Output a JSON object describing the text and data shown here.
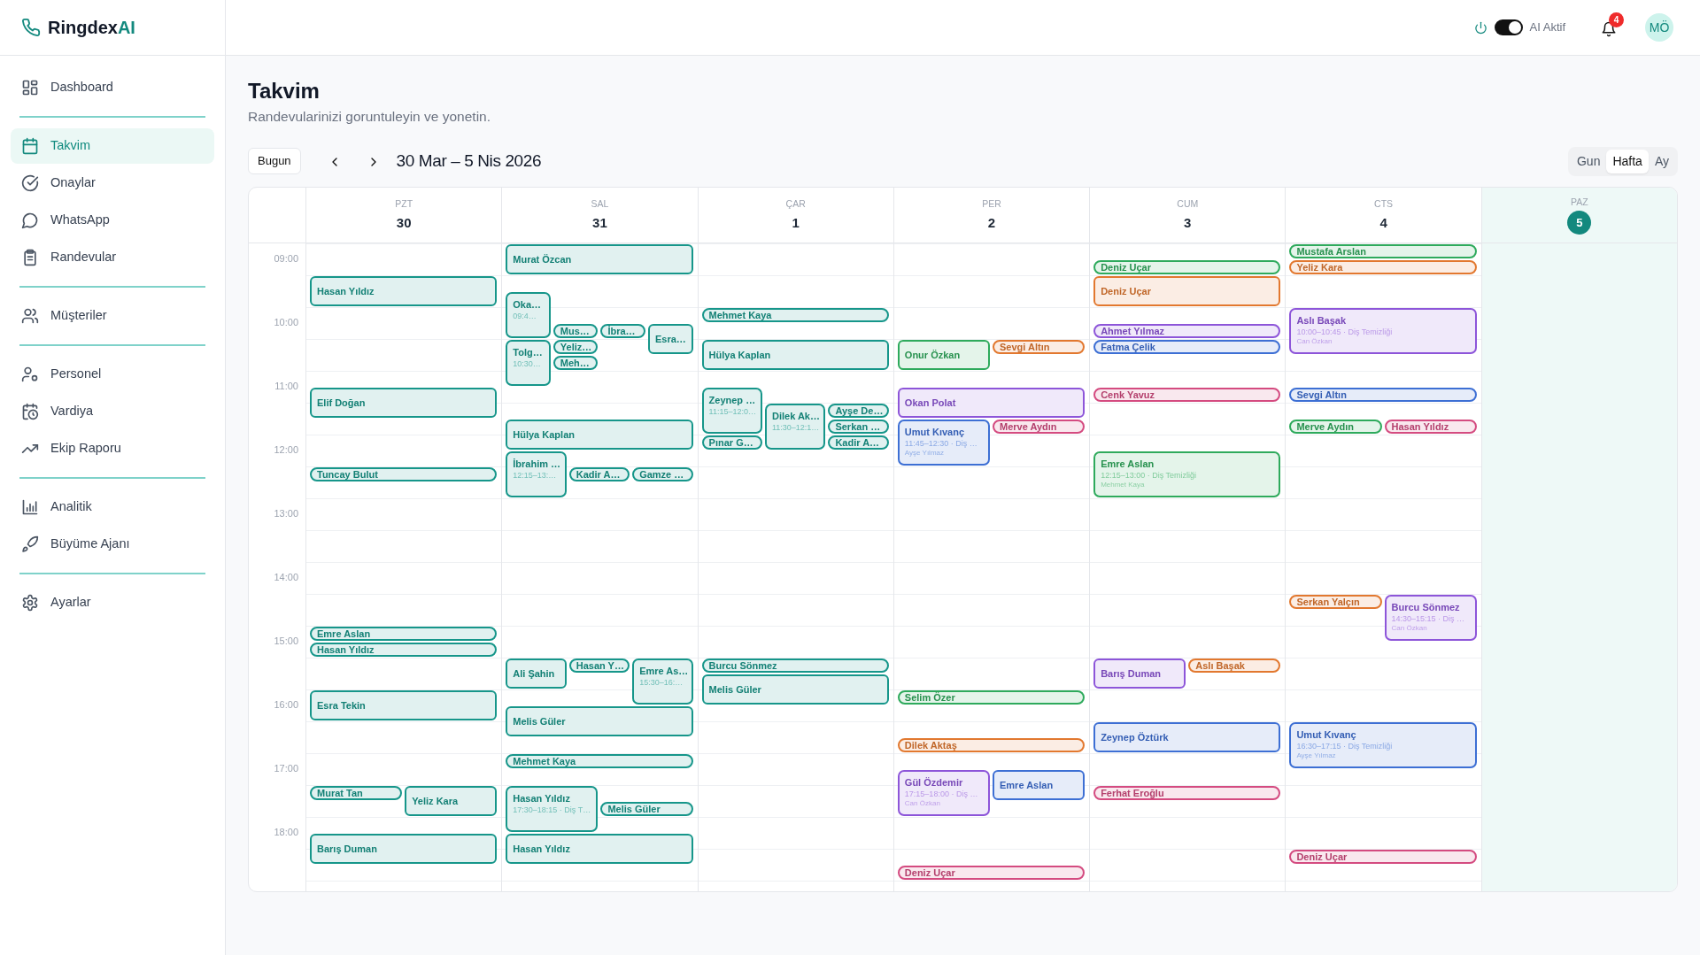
{
  "logo": {
    "name": "Ringdex",
    "suffix": "AI"
  },
  "sidebar": {
    "groups": [
      [
        {
          "label": "Dashboard",
          "selected": false
        }
      ],
      [
        {
          "label": "Takvim",
          "selected": true
        },
        {
          "label": "Onaylar",
          "selected": false
        },
        {
          "label": "WhatsApp",
          "selected": false
        },
        {
          "label": "Randevular",
          "selected": false
        }
      ],
      [
        {
          "label": "Müşteriler",
          "selected": false
        }
      ],
      [
        {
          "label": "Personel",
          "selected": false
        },
        {
          "label": "Vardiya",
          "selected": false
        },
        {
          "label": "Ekip Raporu",
          "selected": false
        }
      ],
      [
        {
          "label": "Analitik",
          "selected": false
        },
        {
          "label": "Büyüme Ajanı",
          "selected": false
        }
      ],
      [
        {
          "label": "Ayarlar",
          "selected": false
        }
      ]
    ]
  },
  "topbar": {
    "ai_toggle": {
      "label": "AI Aktif",
      "on": true
    },
    "notifications": {
      "count": "4"
    },
    "avatar": "MÖ"
  },
  "page": {
    "title": "Takvim",
    "subtitle": "Randevularinizi goruntuleyin ve yonetin."
  },
  "toolbar": {
    "today_button": "Bugun",
    "range": "30 Mar – 5 Nis 2026",
    "views": [
      {
        "label": "Gun",
        "selected": false
      },
      {
        "label": "Hafta",
        "selected": true
      },
      {
        "label": "Ay",
        "selected": false
      }
    ]
  },
  "calendar": {
    "hours": [
      "09:00",
      "10:00",
      "11:00",
      "12:00",
      "13:00",
      "14:00",
      "15:00",
      "16:00",
      "17:00",
      "18:00"
    ],
    "days": [
      {
        "abbr": "PZT",
        "date": "30",
        "today": false,
        "events": [
          {
            "kind": "box",
            "name": "Hasan Yıldız",
            "color": "#16968a"
          },
          {
            "kind": "box",
            "name": "Elif Doğan",
            "color": "#16968a"
          },
          {
            "kind": "pill",
            "name": "Tuncay Bulut",
            "color": "#16968a"
          },
          {
            "kind": "pill",
            "name": "Emre Aslan",
            "color": "#16968a"
          },
          {
            "kind": "pill",
            "name": "Hasan Yıldız",
            "color": "#16968a"
          },
          {
            "kind": "box",
            "name": "Esra Tekin",
            "color": "#16968a"
          },
          {
            "kind": "pill",
            "name": "Murat Tan",
            "color": "#16968a"
          },
          {
            "kind": "box",
            "name": "Yeliz Kara",
            "color": "#16968a"
          },
          {
            "kind": "box",
            "name": "Barış Duman",
            "color": "#16968a"
          }
        ]
      },
      {
        "abbr": "SAL",
        "date": "31",
        "today": false,
        "events": [
          {
            "kind": "box",
            "name": "Murat Özcan",
            "color": "#16968a"
          },
          {
            "kind": "card",
            "name": "Oka…",
            "time": "09:4…",
            "color": "#16968a"
          },
          {
            "kind": "card",
            "name": "Tolg…",
            "time": "10:30…",
            "color": "#16968a"
          },
          {
            "kind": "pill",
            "name": "Mus…",
            "color": "#16968a"
          },
          {
            "kind": "pill",
            "name": "Yeliz…",
            "color": "#16968a"
          },
          {
            "kind": "pill",
            "name": "Meh…",
            "color": "#16968a"
          },
          {
            "kind": "pill",
            "name": "İbra…",
            "color": "#16968a"
          },
          {
            "kind": "box",
            "name": "Esra…",
            "color": "#16968a"
          },
          {
            "kind": "box",
            "name": "Hülya Kaplan",
            "color": "#16968a"
          },
          {
            "kind": "card",
            "name": "İbrahim …",
            "time": "12:15–13:…",
            "color": "#16968a"
          },
          {
            "kind": "pill",
            "name": "Kadir A…",
            "color": "#16968a"
          },
          {
            "kind": "pill",
            "name": "Gamze …",
            "color": "#16968a"
          },
          {
            "kind": "box",
            "name": "Ali Şahin",
            "color": "#16968a"
          },
          {
            "kind": "pill",
            "name": "Hasan Y…",
            "color": "#16968a"
          },
          {
            "kind": "card",
            "name": "Emre As…",
            "time": "15:30–16:…",
            "color": "#16968a"
          },
          {
            "kind": "box",
            "name": "Melis Güler",
            "color": "#16968a"
          },
          {
            "kind": "pill",
            "name": "Mehmet Kaya",
            "color": "#16968a"
          },
          {
            "kind": "card",
            "name": "Hasan Yıldız",
            "time": "17:30–18:15 · Diş T…",
            "color": "#16968a"
          },
          {
            "kind": "pill",
            "name": "Melis Güler",
            "color": "#16968a"
          },
          {
            "kind": "box",
            "name": "Hasan Yıldız",
            "color": "#16968a"
          }
        ]
      },
      {
        "abbr": "ÇAR",
        "date": "1",
        "today": false,
        "events": [
          {
            "kind": "pill",
            "name": "Mehmet Kaya",
            "color": "#16968a"
          },
          {
            "kind": "box",
            "name": "Hülya Kaplan",
            "color": "#16968a"
          },
          {
            "kind": "card",
            "name": "Zeynep …",
            "time": "11:15–12:0…",
            "color": "#16968a"
          },
          {
            "kind": "pill",
            "name": "Pınar G…",
            "color": "#16968a"
          },
          {
            "kind": "card",
            "name": "Dilek Ak…",
            "time": "11:30–12:1…",
            "color": "#16968a"
          },
          {
            "kind": "pill",
            "name": "Ayşe De…",
            "color": "#16968a"
          },
          {
            "kind": "pill",
            "name": "Serkan …",
            "color": "#16968a"
          },
          {
            "kind": "pill",
            "name": "Kadir A…",
            "color": "#16968a"
          },
          {
            "kind": "pill",
            "name": "Burcu Sönmez",
            "color": "#16968a"
          },
          {
            "kind": "box",
            "name": "Melis Güler",
            "color": "#16968a"
          }
        ]
      },
      {
        "abbr": "PER",
        "date": "2",
        "today": false,
        "events": [
          {
            "kind": "box",
            "name": "Onur Özkan",
            "color": "#2eaa5c"
          },
          {
            "kind": "pill",
            "name": "Sevgi Altın",
            "color": "#e2782f"
          },
          {
            "kind": "box",
            "name": "Okan Polat",
            "color": "#8d55d9"
          },
          {
            "kind": "card",
            "name": "Umut Kıvanç",
            "time": "11:45–12:30 · Diş …",
            "staff": "Ayşe Yılmaz",
            "color": "#3d6fd4"
          },
          {
            "kind": "pill",
            "name": "Merve Aydın",
            "color": "#d44b80"
          },
          {
            "kind": "pill",
            "name": "Selim Özer",
            "color": "#2eaa5c"
          },
          {
            "kind": "pill",
            "name": "Dilek Aktaş",
            "color": "#e2782f"
          },
          {
            "kind": "card",
            "name": "Gül Özdemir",
            "time": "17:15–18:00 · Diş …",
            "staff": "Can Özkan",
            "color": "#8d55d9"
          },
          {
            "kind": "box",
            "name": "Emre Aslan",
            "color": "#3d6fd4"
          },
          {
            "kind": "pill",
            "name": "Deniz Uçar",
            "color": "#d44b80"
          }
        ]
      },
      {
        "abbr": "CUM",
        "date": "3",
        "today": false,
        "events": [
          {
            "kind": "pill",
            "name": "Deniz Uçar",
            "color": "#2eaa5c"
          },
          {
            "kind": "box",
            "name": "Deniz Uçar",
            "color": "#e2782f"
          },
          {
            "kind": "pill",
            "name": "Ahmet Yılmaz",
            "color": "#8d55d9"
          },
          {
            "kind": "pill",
            "name": "Fatma Çelik",
            "color": "#3d6fd4"
          },
          {
            "kind": "pill",
            "name": "Cenk Yavuz",
            "color": "#d44b80"
          },
          {
            "kind": "card",
            "name": "Emre Aslan",
            "time": "12:15–13:00 · Diş Temizliği",
            "staff": "Mehmet Kaya",
            "color": "#2eaa5c"
          },
          {
            "kind": "box",
            "name": "Barış Duman",
            "color": "#8d55d9"
          },
          {
            "kind": "pill",
            "name": "Aslı Başak",
            "color": "#e2782f"
          },
          {
            "kind": "box",
            "name": "Zeynep Öztürk",
            "color": "#3d6fd4"
          },
          {
            "kind": "pill",
            "name": "Ferhat Eroğlu",
            "color": "#d44b80"
          }
        ]
      },
      {
        "abbr": "CTS",
        "date": "4",
        "today": false,
        "events": [
          {
            "kind": "pill",
            "name": "Mustafa Arslan",
            "color": "#2eaa5c"
          },
          {
            "kind": "pill",
            "name": "Yeliz Kara",
            "color": "#e2782f"
          },
          {
            "kind": "card",
            "name": "Aslı Başak",
            "time": "10:00–10:45 · Diş Temizliği",
            "staff": "Can Özkan",
            "color": "#8d55d9"
          },
          {
            "kind": "pill",
            "name": "Sevgi Altın",
            "color": "#3d6fd4"
          },
          {
            "kind": "pill",
            "name": "Merve Aydın",
            "color": "#2eaa5c"
          },
          {
            "kind": "pill",
            "name": "Hasan Yıldız",
            "color": "#d44b80"
          },
          {
            "kind": "pill",
            "name": "Serkan Yalçın",
            "color": "#e2782f"
          },
          {
            "kind": "card",
            "name": "Burcu Sönmez",
            "time": "14:30–15:15 · Diş …",
            "staff": "Can Özkan",
            "color": "#8d55d9"
          },
          {
            "kind": "card",
            "name": "Umut Kıvanç",
            "time": "16:30–17:15 · Diş Temizliği",
            "staff": "Ayşe Yılmaz",
            "color": "#3d6fd4"
          },
          {
            "kind": "pill",
            "name": "Deniz Uçar",
            "color": "#d44b80"
          }
        ]
      },
      {
        "abbr": "PAZ",
        "date": "5",
        "today": true
      }
    ]
  }
}
